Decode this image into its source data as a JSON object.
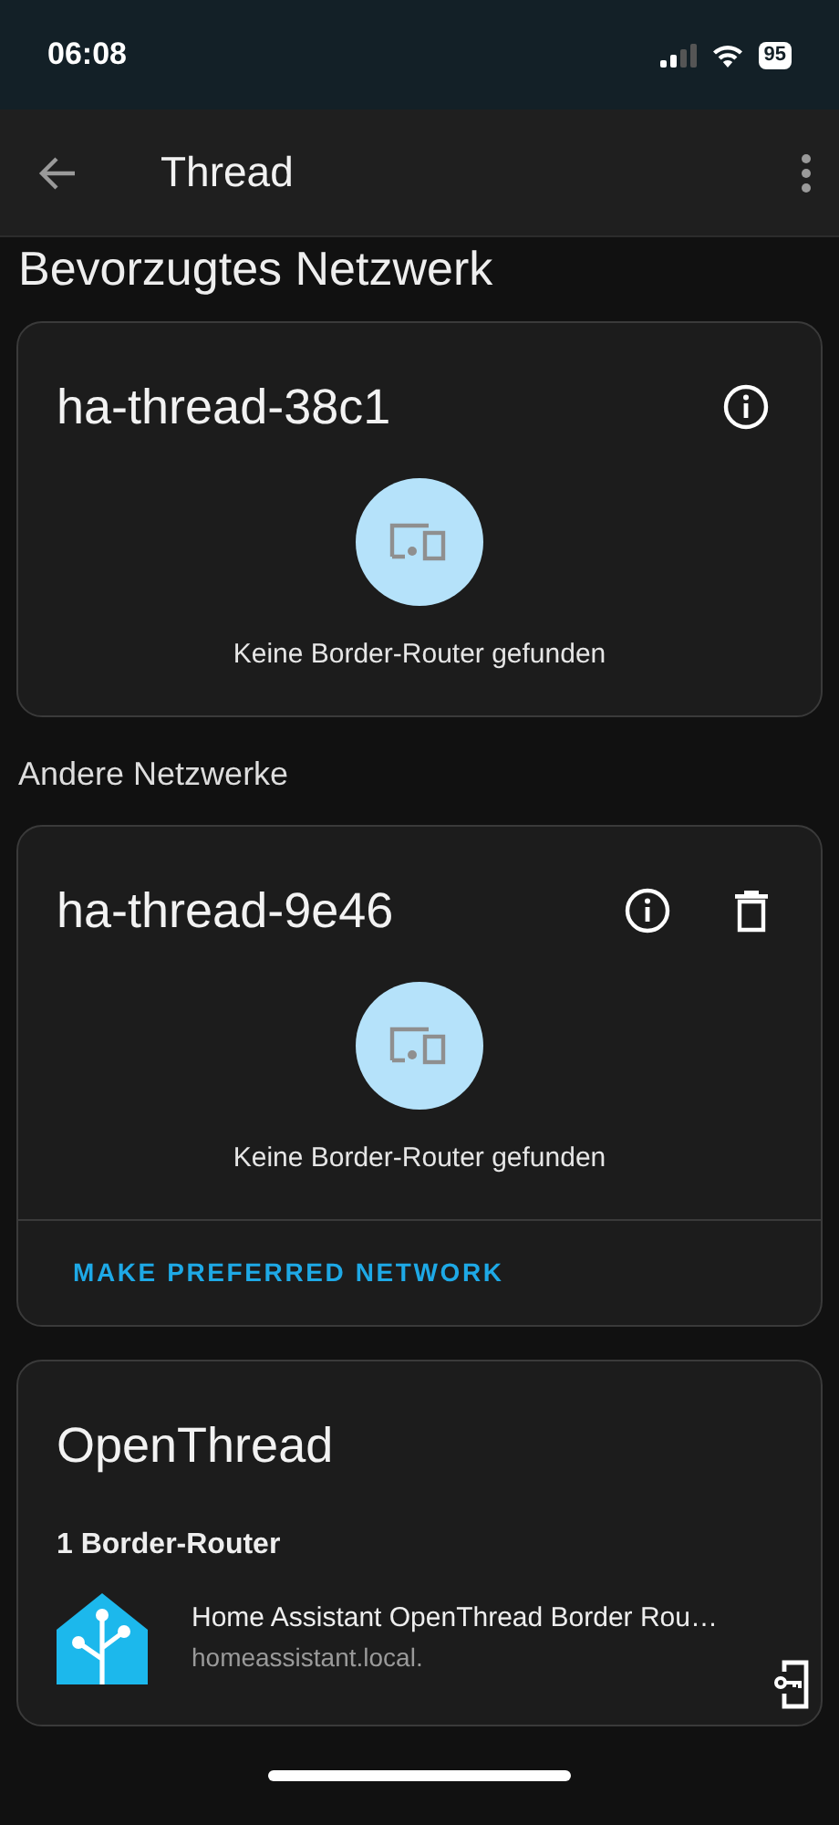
{
  "status_bar": {
    "time": "06:08",
    "battery": "95"
  },
  "app_bar": {
    "title": "Thread"
  },
  "content": [
    {
      "kind": "heading",
      "text": "Bevorzugtes Netzwerk"
    },
    {
      "kind": "network",
      "name": "ha-thread-38c1",
      "actions": [
        {
          "kind": "info"
        }
      ],
      "status": "Keine Border-Router gefunden"
    },
    {
      "kind": "subheading",
      "text": "Andere Netzwerke"
    },
    {
      "kind": "network",
      "name": "ha-thread-9e46",
      "actions": [
        {
          "kind": "info"
        },
        {
          "kind": "delete"
        }
      ],
      "status": "Keine Border-Router gefunden",
      "footer_button": "MAKE PREFERRED NETWORK"
    },
    {
      "kind": "routers",
      "name": "OpenThread",
      "routers_heading": "1 Border-Router",
      "routers": [
        {
          "name": "Home Assistant OpenThread Border Rou…",
          "host": "homeassistant.local."
        }
      ]
    }
  ]
}
